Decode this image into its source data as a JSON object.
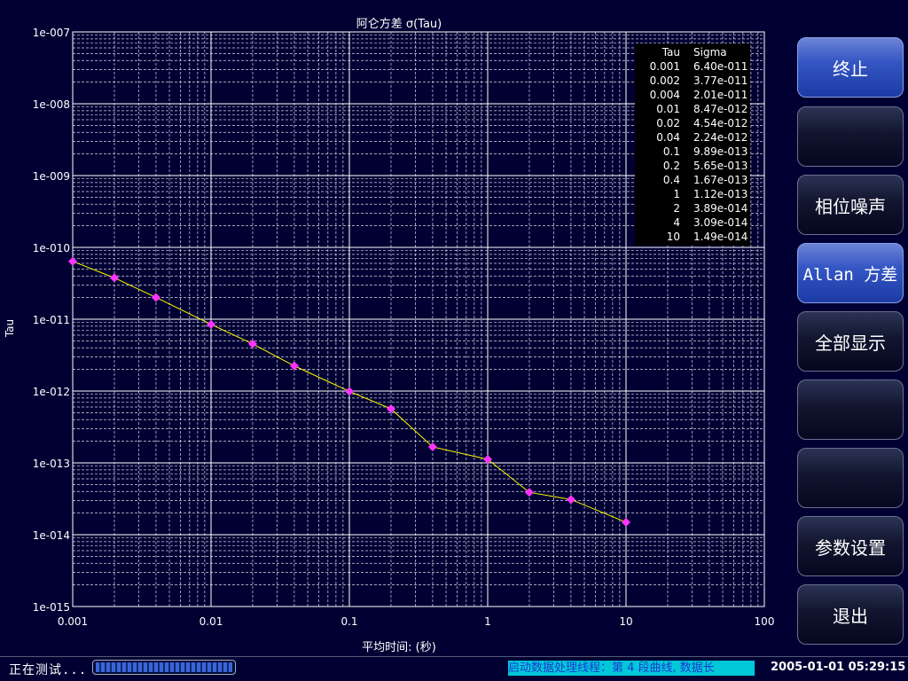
{
  "chart_data": {
    "type": "line",
    "title": "阿仑方差 σ(Tau)",
    "xlabel": "平均时间: (秒)",
    "ylabel": "Tau",
    "xscale": "log",
    "yscale": "log",
    "xlim": [
      0.001,
      100
    ],
    "ylim": [
      1e-15,
      1e-07
    ],
    "x_ticks": [
      "0.001",
      "0.01",
      "0.1",
      "1",
      "10",
      "100"
    ],
    "y_ticks": [
      "1e-007",
      "1e-008",
      "1e-009",
      "1e-010",
      "1e-011",
      "1e-012",
      "1e-013",
      "1e-014",
      "1e-015"
    ],
    "grid": true,
    "colors": {
      "line": "#ffff00",
      "marker": "#ff33ff"
    },
    "series": [
      {
        "x": [
          0.001,
          0.002,
          0.004,
          0.01,
          0.02,
          0.04,
          0.1,
          0.2,
          0.4,
          1,
          2,
          4,
          10
        ],
        "y": [
          6.4e-11,
          3.77e-11,
          2.01e-11,
          8.47e-12,
          4.54e-12,
          2.24e-12,
          9.89e-13,
          5.65e-13,
          1.67e-13,
          1.12e-13,
          3.89e-14,
          3.09e-14,
          1.49e-14
        ]
      }
    ],
    "table": {
      "headers": [
        "Tau",
        "Sigma"
      ],
      "rows": [
        [
          "0.001",
          "6.40e-011"
        ],
        [
          "0.002",
          "3.77e-011"
        ],
        [
          "0.004",
          "2.01e-011"
        ],
        [
          "0.01",
          "8.47e-012"
        ],
        [
          "0.02",
          "4.54e-012"
        ],
        [
          "0.04",
          "2.24e-012"
        ],
        [
          "0.1",
          "9.89e-013"
        ],
        [
          "0.2",
          "5.65e-013"
        ],
        [
          "0.4",
          "1.67e-013"
        ],
        [
          "1",
          "1.12e-013"
        ],
        [
          "2",
          "3.89e-014"
        ],
        [
          "4",
          "3.09e-014"
        ],
        [
          "10",
          "1.49e-014"
        ]
      ]
    }
  },
  "sidebar": {
    "buttons": [
      {
        "label": "终止",
        "active": true
      },
      {
        "label": "",
        "active": false
      },
      {
        "label": "相位噪声",
        "active": false
      },
      {
        "label": "Allan 方差",
        "active": true
      },
      {
        "label": "全部显示",
        "active": false
      },
      {
        "label": "",
        "active": false
      },
      {
        "label": "",
        "active": false
      },
      {
        "label": "参数设置",
        "active": false
      },
      {
        "label": "退出",
        "active": false
      }
    ]
  },
  "status": {
    "text": "正在测试...",
    "progress": 1.0,
    "message": "启动数据处理线程：第 4 段曲线, 数据长",
    "datetime": "2005-01-01 05:29:15"
  }
}
